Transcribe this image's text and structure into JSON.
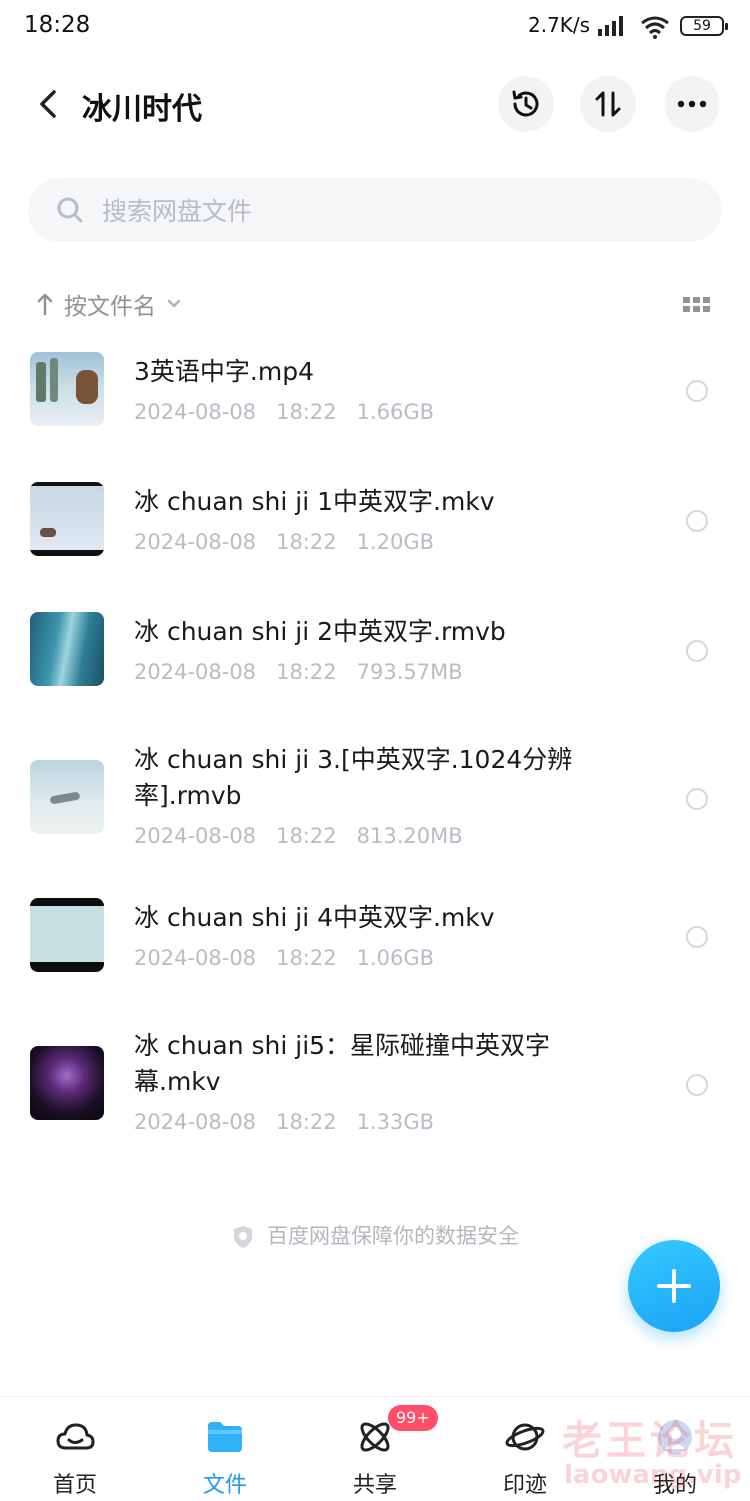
{
  "status_bar": {
    "time": "18:28",
    "network_speed": "2.7K/s",
    "battery": "59"
  },
  "header": {
    "title": "冰川时代"
  },
  "search": {
    "placeholder": "搜索网盘文件"
  },
  "sort": {
    "label": "按文件名"
  },
  "files": [
    {
      "name": "3英语中字.mp4",
      "date": "2024-08-08",
      "time": "18:22",
      "size": "1.66GB"
    },
    {
      "name": "冰 chuan shi ji 1中英双字.mkv",
      "date": "2024-08-08",
      "time": "18:22",
      "size": "1.20GB"
    },
    {
      "name": "冰 chuan shi ji 2中英双字.rmvb",
      "date": "2024-08-08",
      "time": "18:22",
      "size": "793.57MB"
    },
    {
      "name": "冰 chuan shi ji 3.[中英双字.1024分辨率].rmvb",
      "date": "2024-08-08",
      "time": "18:22",
      "size": "813.20MB"
    },
    {
      "name": "冰 chuan shi ji 4中英双字.mkv",
      "date": "2024-08-08",
      "time": "18:22",
      "size": "1.06GB"
    },
    {
      "name": "冰 chuan shi ji5：星际碰撞中英双字幕.mkv",
      "date": "2024-08-08",
      "time": "18:22",
      "size": "1.33GB"
    }
  ],
  "footer": {
    "security_note": "百度网盘保障你的数据安全"
  },
  "bottom_nav": {
    "items": [
      {
        "label": "首页",
        "icon": "cloud-icon"
      },
      {
        "label": "文件",
        "icon": "folder-icon",
        "active": true
      },
      {
        "label": "共享",
        "icon": "atom-icon",
        "badge": "99+"
      },
      {
        "label": "印迹",
        "icon": "planet-icon"
      },
      {
        "label": "我的",
        "icon": "profile-icon"
      }
    ]
  },
  "watermark": {
    "line1": "老王论坛",
    "line2": "laowang.vip"
  },
  "colors": {
    "accent": "#1f9bf0",
    "badge": "#ff4d6a",
    "muted_text": "#b8bcc4"
  }
}
